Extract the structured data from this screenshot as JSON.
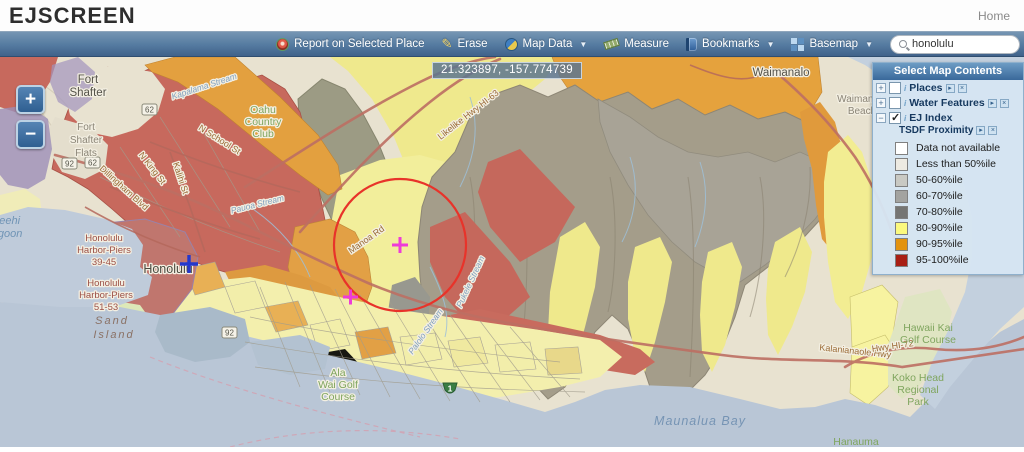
{
  "header": {
    "title": "EJSCREEN",
    "home_label": "Home"
  },
  "toolbar": {
    "report_label": "Report on Selected Place",
    "erase_label": "Erase",
    "map_data_label": "Map Data",
    "measure_label": "Measure",
    "bookmarks_label": "Bookmarks",
    "basemap_label": "Basemap",
    "search": {
      "value": "honolulu"
    }
  },
  "map": {
    "coordinates": "21.323897, -157.774739",
    "zoom_in": "+",
    "zoom_out": "−",
    "labels": {
      "fort_shafter": [
        "Fort",
        "Shafter"
      ],
      "fort_shafter_flats": [
        "Fort",
        "Shafter",
        "Flats"
      ],
      "waimanalo": "Waimanalo",
      "waimanalo_beach": [
        "Waimanalo",
        "Beach"
      ],
      "honolulu": "Honolulu",
      "keehi_lagoon": [
        "Keehi",
        "Lagoon"
      ],
      "harbor_piers_1": [
        "Honolulu",
        "Harbor-Piers",
        "39-45"
      ],
      "harbor_piers_2": [
        "Honolulu",
        "Harbor-Piers",
        "51-53"
      ],
      "sand_island": [
        "Sand",
        "Island"
      ],
      "maunalua_bay": "Maunalua Bay",
      "hawaii_kai": [
        "Hawaii Kai",
        "Golf Course"
      ],
      "koko_head": [
        "Koko Head",
        "Regional",
        "Park"
      ],
      "hanauma": "Hanauma",
      "oahu_country_club": [
        "Oahu",
        "Country",
        "Club"
      ],
      "ala_wai": [
        "Ala",
        "Wai Golf",
        "Course"
      ]
    },
    "roads": {
      "likelike": "Likelike Hwy HI-63",
      "kalanianaole": "Kalanianaole Hwy",
      "hwy72": "Hwy  HI-72",
      "manoa": "Manoa Rd",
      "dillingham": "Dillingham Blvd",
      "n_king": "N King St",
      "kalihi": "Kalihi St",
      "n_school": "N School St",
      "kapalama": "Kapalama Stream",
      "pauoa": "Pauoa Stream",
      "palolo": "Palolo Stream",
      "pukele": "Pukele Stream"
    },
    "shields": {
      "s92": "92",
      "s62": "62",
      "h1": "1"
    }
  },
  "panel": {
    "title": "Select Map Contents",
    "layers": [
      {
        "label": "Places",
        "checked": false
      },
      {
        "label": "Water Features",
        "checked": false
      },
      {
        "label": "EJ Index",
        "checked": true
      }
    ],
    "sublayer": "TSDF Proximity",
    "legend": [
      {
        "label": "Data not available",
        "color": "#ffffff"
      },
      {
        "label": "Less than 50%ile",
        "color": "#edeae2"
      },
      {
        "label": "50-60%ile",
        "color": "#c9c9c3"
      },
      {
        "label": "60-70%ile",
        "color": "#a3a3a0"
      },
      {
        "label": "70-80%ile",
        "color": "#757573"
      },
      {
        "label": "80-90%ile",
        "color": "#fbf97e"
      },
      {
        "label": "90-95%ile",
        "color": "#e3930f"
      },
      {
        "label": "95-100%ile",
        "color": "#a81f15"
      }
    ]
  }
}
